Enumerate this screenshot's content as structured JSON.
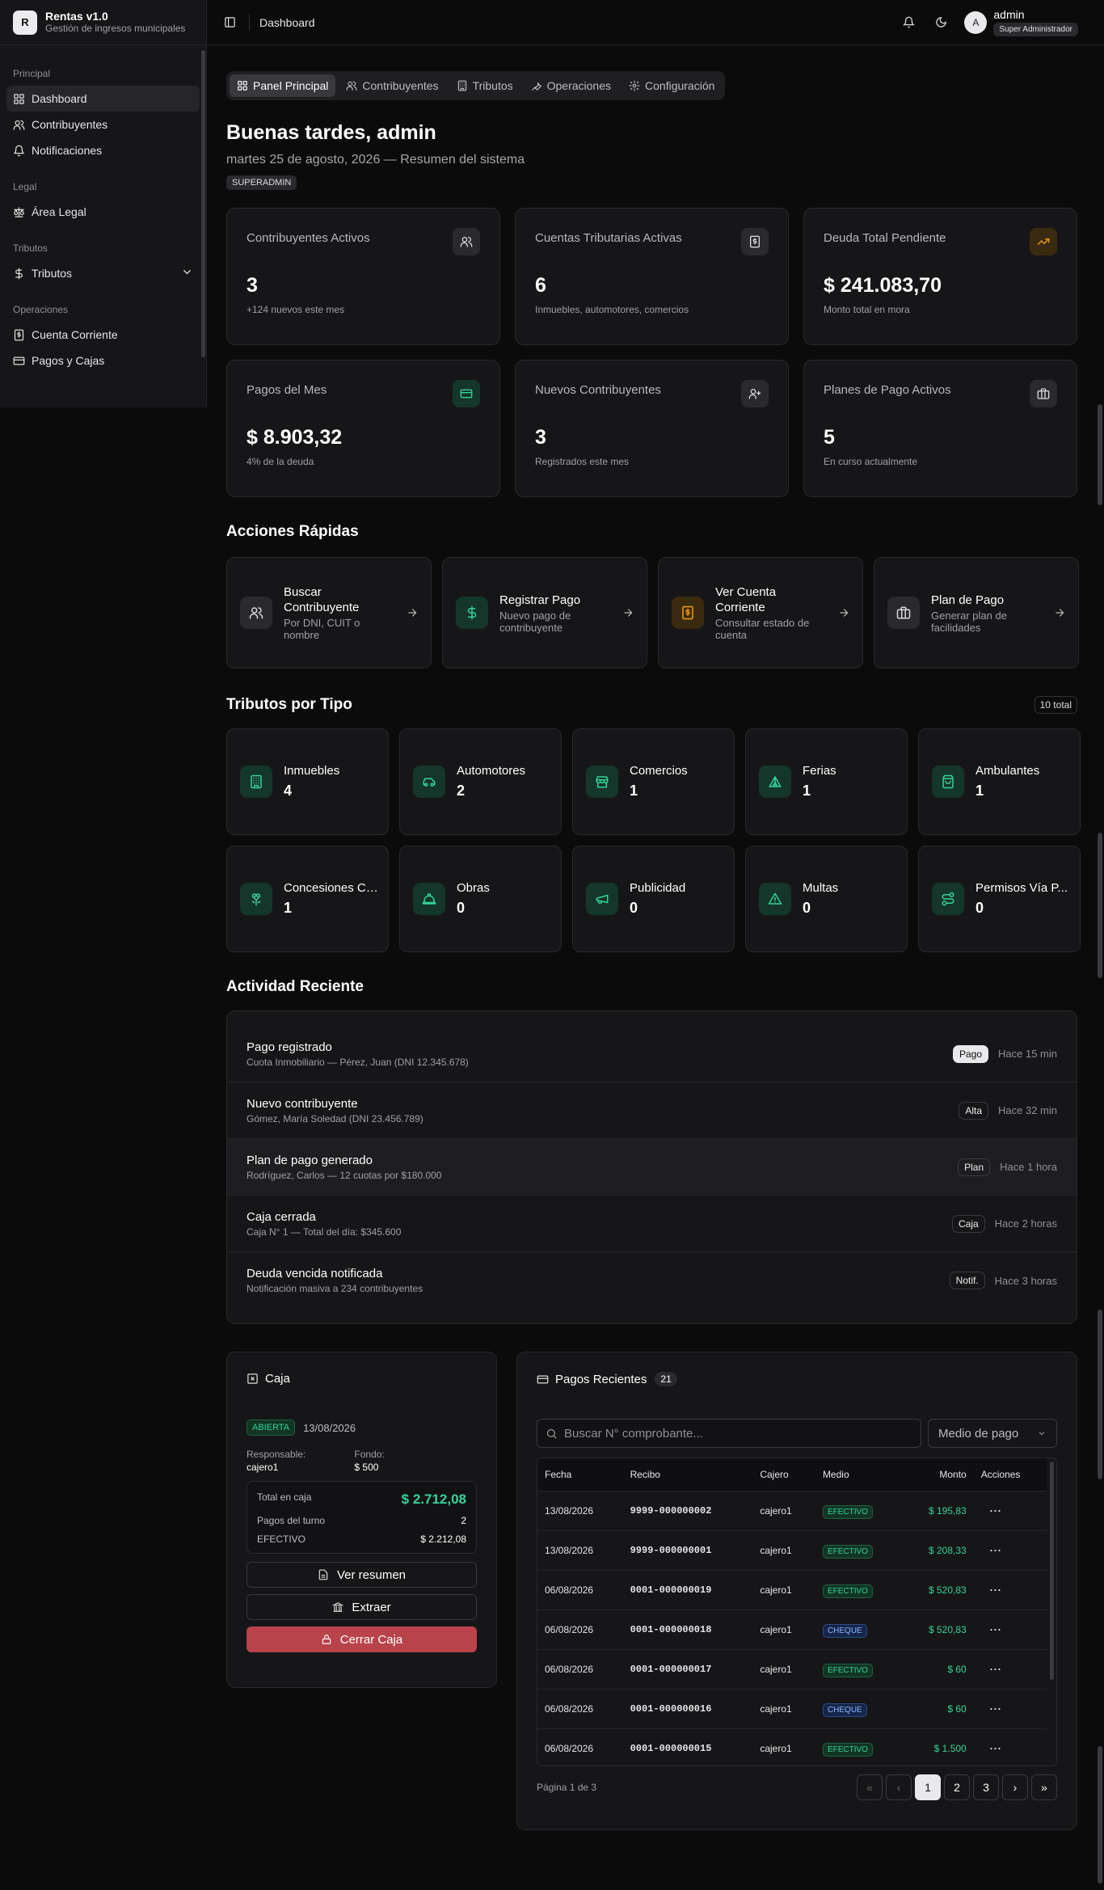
{
  "app": {
    "name": "Rentas v1.0",
    "subtitle": "Gestión de ingresos municipales",
    "logo_letter": "R"
  },
  "sidebar": {
    "groups": [
      {
        "label": "Principal",
        "items": [
          {
            "label": "Dashboard",
            "icon": "dashboard-icon",
            "active": true
          },
          {
            "label": "Contribuyentes",
            "icon": "users-icon"
          },
          {
            "label": "Notificaciones",
            "icon": "bell-icon"
          }
        ]
      },
      {
        "label": "Legal",
        "items": [
          {
            "label": "Área Legal",
            "icon": "scale-icon"
          }
        ]
      },
      {
        "label": "Tributos",
        "items": [
          {
            "label": "Tributos",
            "icon": "dollar-icon",
            "has_chevron": true
          }
        ]
      },
      {
        "label": "Operaciones",
        "items": [
          {
            "label": "Cuenta Corriente",
            "icon": "receipt-icon"
          },
          {
            "label": "Pagos y Cajas",
            "icon": "card-icon"
          }
        ]
      }
    ]
  },
  "topbar": {
    "title": "Dashboard",
    "user": {
      "name": "admin",
      "role": "Super Administrador",
      "initial": "A"
    }
  },
  "tabs": [
    {
      "label": "Panel Principal",
      "icon": "dashboard-icon",
      "active": true
    },
    {
      "label": "Contribuyentes",
      "icon": "users-icon"
    },
    {
      "label": "Tributos",
      "icon": "building-icon"
    },
    {
      "label": "Operaciones",
      "icon": "wrench-icon"
    },
    {
      "label": "Configuración",
      "icon": "gear-icon"
    }
  ],
  "greeting": {
    "title": "Buenas tardes, admin",
    "date": "martes 25 de agosto, 2026 — Resumen del sistema",
    "badge": "SUPERADMIN"
  },
  "stats": [
    {
      "label": "Contribuyentes Activos",
      "value": "3",
      "sub": "+124 nuevos este mes",
      "icon": "users-icon",
      "tone": "neutral"
    },
    {
      "label": "Cuentas Tributarias Activas",
      "value": "6",
      "sub": "Inmuebles, automotores, comercios",
      "icon": "receipt-icon",
      "tone": "neutral"
    },
    {
      "label": "Deuda Total Pendiente",
      "value": "$ 241.083,70",
      "sub": "Monto total en mora",
      "icon": "trending-up-icon",
      "tone": "amber"
    },
    {
      "label": "Pagos del Mes",
      "value": "$ 8.903,32",
      "sub": "4% de la deuda",
      "icon": "card-icon",
      "tone": "green"
    },
    {
      "label": "Nuevos Contribuyentes",
      "value": "3",
      "sub": "Registrados este mes",
      "icon": "user-plus-icon",
      "tone": "neutral"
    },
    {
      "label": "Planes de Pago Activos",
      "value": "5",
      "sub": "En curso actualmente",
      "icon": "briefcase-icon",
      "tone": "neutral"
    }
  ],
  "quick_actions": {
    "title": "Acciones Rápidas",
    "items": [
      {
        "title": "Buscar Contribuyente",
        "sub": "Por DNI, CUIT o nombre",
        "icon": "users-icon",
        "tone": "neutral"
      },
      {
        "title": "Registrar Pago",
        "sub": "Nuevo pago de contribuyente",
        "icon": "dollar-icon",
        "tone": "green"
      },
      {
        "title": "Ver Cuenta Corriente",
        "sub": "Consultar estado de cuenta",
        "icon": "receipt-icon",
        "tone": "amber"
      },
      {
        "title": "Plan de Pago",
        "sub": "Generar plan de facilidades",
        "icon": "briefcase-icon",
        "tone": "neutral"
      }
    ]
  },
  "tributos": {
    "title": "Tributos por Tipo",
    "total_badge": "10 total",
    "items": [
      {
        "name": "Inmuebles",
        "count": "4",
        "icon": "building-icon"
      },
      {
        "name": "Automotores",
        "count": "2",
        "icon": "car-icon"
      },
      {
        "name": "Comercios",
        "count": "1",
        "icon": "store-icon"
      },
      {
        "name": "Ferias",
        "count": "1",
        "icon": "tent-icon"
      },
      {
        "name": "Ambulantes",
        "count": "1",
        "icon": "bag-icon"
      },
      {
        "name": "Concesiones Ce...",
        "count": "1",
        "icon": "flower-icon"
      },
      {
        "name": "Obras",
        "count": "0",
        "icon": "hardhat-icon"
      },
      {
        "name": "Publicidad",
        "count": "0",
        "icon": "megaphone-icon"
      },
      {
        "name": "Multas",
        "count": "0",
        "icon": "warning-icon"
      },
      {
        "name": "Permisos Vía P...",
        "count": "0",
        "icon": "route-icon"
      }
    ]
  },
  "activity": {
    "title": "Actividad Reciente",
    "items": [
      {
        "title": "Pago registrado",
        "desc": "Cuota Inmobiliario — Pérez, Juan (DNI 12.345.678)",
        "badge": "Pago",
        "time": "Hace 15 min",
        "solid": true
      },
      {
        "title": "Nuevo contribuyente",
        "desc": "Gómez, María Soledad (DNI 23.456.789)",
        "badge": "Alta",
        "time": "Hace 32 min"
      },
      {
        "title": "Plan de pago generado",
        "desc": "Rodríguez, Carlos — 12 cuotas por $180.000",
        "badge": "Plan",
        "time": "Hace 1 hora",
        "highlight": true
      },
      {
        "title": "Caja cerrada",
        "desc": "Caja N° 1 — Total del día: $345.600",
        "badge": "Caja",
        "time": "Hace 2 horas"
      },
      {
        "title": "Deuda vencida notificada",
        "desc": "Notificación masiva a 234 contribuyentes",
        "badge": "Notif.",
        "time": "Hace 3 horas"
      }
    ]
  },
  "caja": {
    "title": "Caja",
    "status": "ABIERTA",
    "date": "13/08/2026",
    "responsable_label": "Responsable:",
    "responsable": "cajero1",
    "fondo_label": "Fondo:",
    "fondo": "$ 500",
    "total_label": "Total en caja",
    "total": "$ 2.712,08",
    "pagos_label": "Pagos del turno",
    "pagos": "2",
    "efectivo_label": "EFECTIVO",
    "efectivo": "$ 2.212,08",
    "btn_resumen": "Ver resumen",
    "btn_extraer": "Extraer",
    "btn_cerrar": "Cerrar Caja"
  },
  "pagos": {
    "title": "Pagos Recientes",
    "count": "21",
    "search_placeholder": "Buscar N° comprobante...",
    "medio_select": "Medio de pago",
    "columns": [
      "Fecha",
      "Recibo",
      "Cajero",
      "Medio",
      "Monto",
      "Acciones"
    ],
    "rows": [
      {
        "fecha": "13/08/2026",
        "recibo": "9999-000000002",
        "cajero": "cajero1",
        "medio": "EFECTIVO",
        "monto": "$ 195,83"
      },
      {
        "fecha": "13/08/2026",
        "recibo": "9999-000000001",
        "cajero": "cajero1",
        "medio": "EFECTIVO",
        "monto": "$ 208,33"
      },
      {
        "fecha": "06/08/2026",
        "recibo": "0001-000000019",
        "cajero": "cajero1",
        "medio": "EFECTIVO",
        "monto": "$ 520,83"
      },
      {
        "fecha": "06/08/2026",
        "recibo": "0001-000000018",
        "cajero": "cajero1",
        "medio": "CHEQUE",
        "monto": "$ 520,83"
      },
      {
        "fecha": "06/08/2026",
        "recibo": "0001-000000017",
        "cajero": "cajero1",
        "medio": "EFECTIVO",
        "monto": "$ 60"
      },
      {
        "fecha": "06/08/2026",
        "recibo": "0001-000000016",
        "cajero": "cajero1",
        "medio": "CHEQUE",
        "monto": "$ 60"
      },
      {
        "fecha": "06/08/2026",
        "recibo": "0001-000000015",
        "cajero": "cajero1",
        "medio": "EFECTIVO",
        "monto": "$ 1.500"
      }
    ],
    "page_info": "Página 1 de 3",
    "pages": [
      "«",
      "‹",
      "1",
      "2",
      "3",
      "›",
      "»"
    ],
    "current_page": "1"
  },
  "colors": {
    "accent_green": "#34d399",
    "danger": "#b8434a",
    "amber": "#f59e0b",
    "bg": "#0b0b0c",
    "card": "#161618"
  }
}
